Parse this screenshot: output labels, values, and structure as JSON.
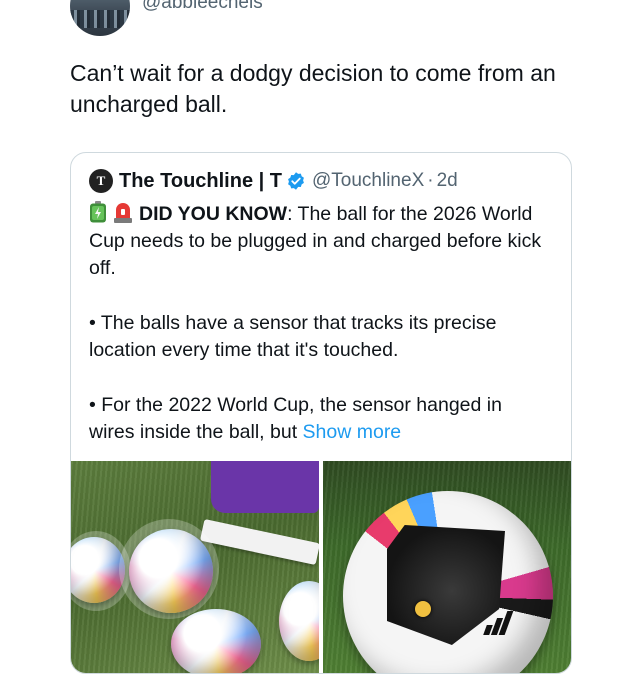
{
  "author": {
    "handle": "@abbieechels"
  },
  "tweet": {
    "text": "Can’t wait for a dodgy decision to come from an uncharged ball."
  },
  "quote": {
    "avatar_letter": "T",
    "name": "The Touchline | T",
    "verified": true,
    "handle": "@TouchlineX",
    "separator": "·",
    "age": "2d",
    "emojis": [
      "battery-emoji",
      "siren-emoji"
    ],
    "lead_label": "DID YOU KNOW",
    "lead_text": ": The ball for the 2026 World Cup needs to be plugged in and charged before kick off.",
    "bullet_1": "• The balls have a sensor that tracks its precise location every time that it's touched.",
    "bullet_2": "• For the 2022 World Cup, the sensor hanged in wires inside the ball, but ",
    "show_more": "Show more"
  },
  "colors": {
    "link": "#1d9bf0",
    "verified_badge": "#1d9bf0",
    "secondary_text": "#536471",
    "border": "#cfd9de"
  },
  "media": [
    {
      "name": "balls-charging-photo"
    },
    {
      "name": "open-ball-sensor-photo"
    }
  ]
}
